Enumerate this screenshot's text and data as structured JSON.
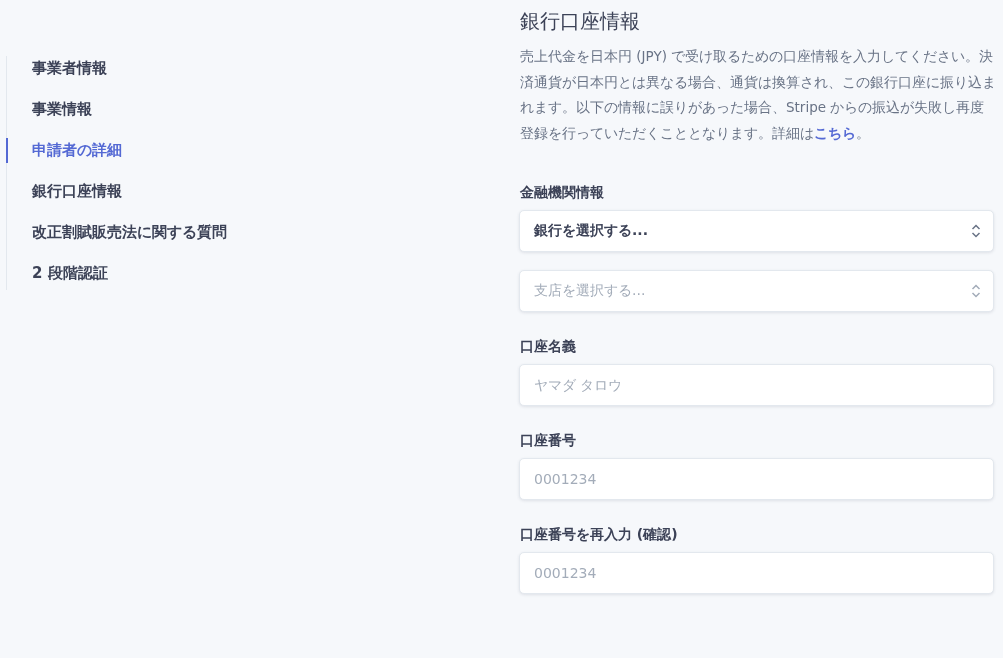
{
  "sidebar": {
    "items": [
      {
        "label": "事業者情報",
        "selected": false
      },
      {
        "label": "事業情報",
        "selected": false
      },
      {
        "label": "申請者の詳細",
        "selected": true
      },
      {
        "label": "銀行口座情報",
        "selected": false
      },
      {
        "label": "改正割賦販売法に関する質問",
        "selected": false
      },
      {
        "label": "2 段階認証",
        "selected": false
      }
    ]
  },
  "section": {
    "title": "銀行口座情報",
    "description": "売上代金を日本円 (JPY) で受け取るための口座情報を入力してください。決済通貨が日本円とは異なる場合、通貨は換算され、この銀行口座に振り込まれます。以下の情報に誤りがあった場合、Stripe からの振込が失敗し再度登録を行っていただくこととなります。詳細は",
    "link": "こちら",
    "description_end": "。"
  },
  "groups": [
    {
      "label": "金融機関情報",
      "fields": [
        {
          "kind": "select",
          "value": "銀行を選択する...",
          "disabled": false
        },
        {
          "kind": "select",
          "value": "支店を選択する...",
          "disabled": true
        }
      ]
    },
    {
      "label": "口座名義",
      "fields": [
        {
          "kind": "input",
          "placeholder": "ヤマダ タロウ"
        }
      ]
    },
    {
      "label": "口座番号",
      "fields": [
        {
          "kind": "input",
          "placeholder": "0001234"
        }
      ]
    },
    {
      "label": "口座番号を再入力 (確認)",
      "fields": [
        {
          "kind": "input",
          "placeholder": "0001234"
        }
      ]
    }
  ]
}
